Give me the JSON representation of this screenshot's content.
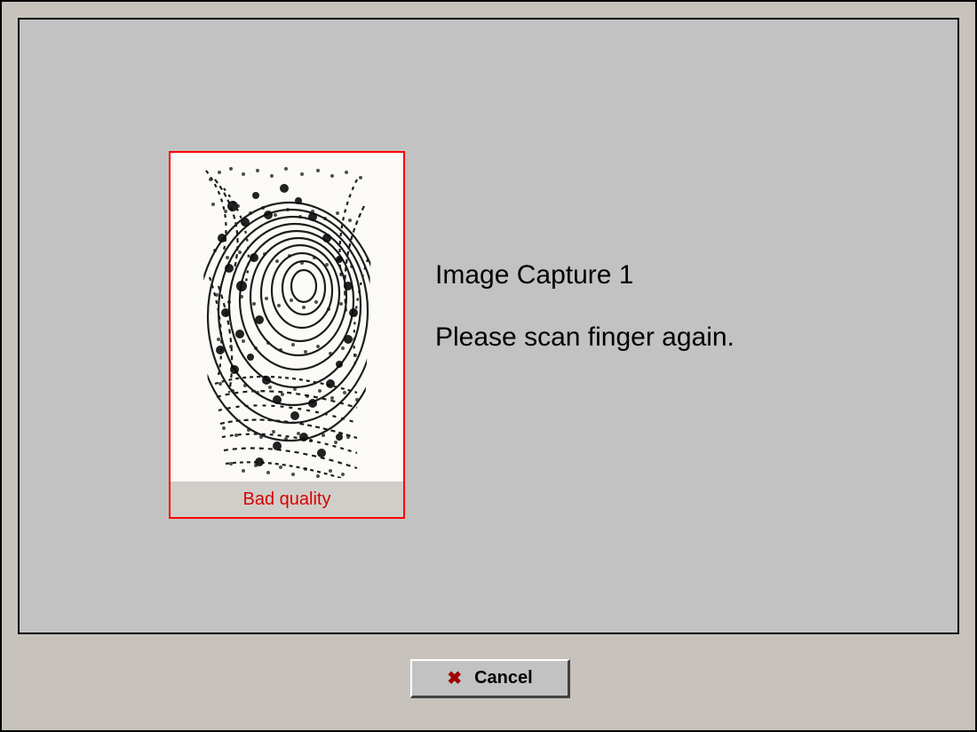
{
  "capture": {
    "title": "Image Capture 1",
    "instruction": "Please scan finger again.",
    "quality_label": "Bad quality",
    "quality_color": "#d80000",
    "border_color": "#f00"
  },
  "buttons": {
    "cancel_label": "Cancel",
    "cancel_icon": "✖"
  },
  "icons": {
    "cancel": "close-icon"
  },
  "colors": {
    "panel_bg": "#c2c2c2",
    "outer_bg": "#c7c2bc",
    "error_red": "#d80000"
  }
}
